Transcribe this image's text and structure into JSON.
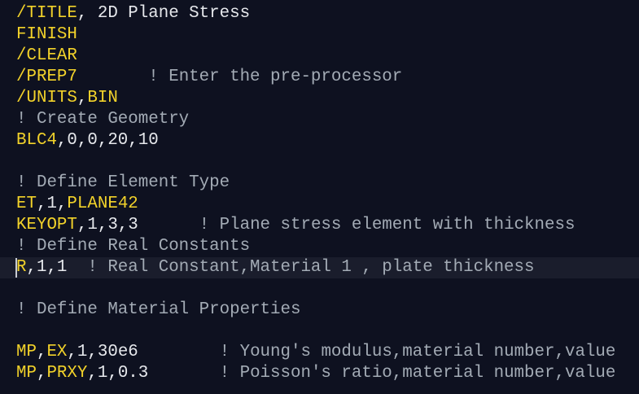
{
  "editor": {
    "colors": {
      "background": "#0e1120",
      "keyword": "#f2d22a",
      "text": "#e6e8ec",
      "comment": "#a3abb5",
      "current_line": "#1a1d2c"
    },
    "current_line_index": 12,
    "lines": [
      [
        {
          "t": "/TITLE",
          "k": "kw"
        },
        {
          "t": ", 2D Plane Stress",
          "k": "tx"
        }
      ],
      [
        {
          "t": "FINISH",
          "k": "kw"
        }
      ],
      [
        {
          "t": "/CLEAR",
          "k": "kw"
        }
      ],
      [
        {
          "t": "/PREP7",
          "k": "kw"
        },
        {
          "t": "       ! Enter the pre-processor",
          "k": "cm"
        }
      ],
      [
        {
          "t": "/UNITS",
          "k": "kw"
        },
        {
          "t": ",",
          "k": "tx"
        },
        {
          "t": "BIN",
          "k": "kw"
        }
      ],
      [
        {
          "t": "! Create Geometry",
          "k": "cm"
        }
      ],
      [
        {
          "t": "BLC4",
          "k": "kw"
        },
        {
          "t": ",0,0,20,10",
          "k": "tx"
        }
      ],
      [],
      [
        {
          "t": "! Define Element Type",
          "k": "cm"
        }
      ],
      [
        {
          "t": "ET",
          "k": "kw"
        },
        {
          "t": ",1,",
          "k": "tx"
        },
        {
          "t": "PLANE42",
          "k": "kw"
        }
      ],
      [
        {
          "t": "KEYOPT",
          "k": "kw"
        },
        {
          "t": ",1,3,3",
          "k": "tx"
        },
        {
          "t": "      ! Plane stress element with thickness",
          "k": "cm"
        }
      ],
      [
        {
          "t": "! Define Real Constants",
          "k": "cm"
        }
      ],
      [
        {
          "t": "R",
          "k": "kw"
        },
        {
          "t": ",1,1",
          "k": "tx"
        },
        {
          "t": "  ! Real Constant,Material 1 , plate thickness",
          "k": "cm"
        }
      ],
      [],
      [
        {
          "t": "! Define Material Properties",
          "k": "cm"
        }
      ],
      [],
      [
        {
          "t": "MP",
          "k": "kw"
        },
        {
          "t": ",",
          "k": "tx"
        },
        {
          "t": "EX",
          "k": "kw"
        },
        {
          "t": ",1,30e6",
          "k": "tx"
        },
        {
          "t": "        ! Young's modulus,material number,value",
          "k": "cm"
        }
      ],
      [
        {
          "t": "MP",
          "k": "kw"
        },
        {
          "t": ",",
          "k": "tx"
        },
        {
          "t": "PRXY",
          "k": "kw"
        },
        {
          "t": ",1,0.3",
          "k": "tx"
        },
        {
          "t": "       ! Poisson's ratio,material number,value",
          "k": "cm"
        }
      ]
    ]
  }
}
